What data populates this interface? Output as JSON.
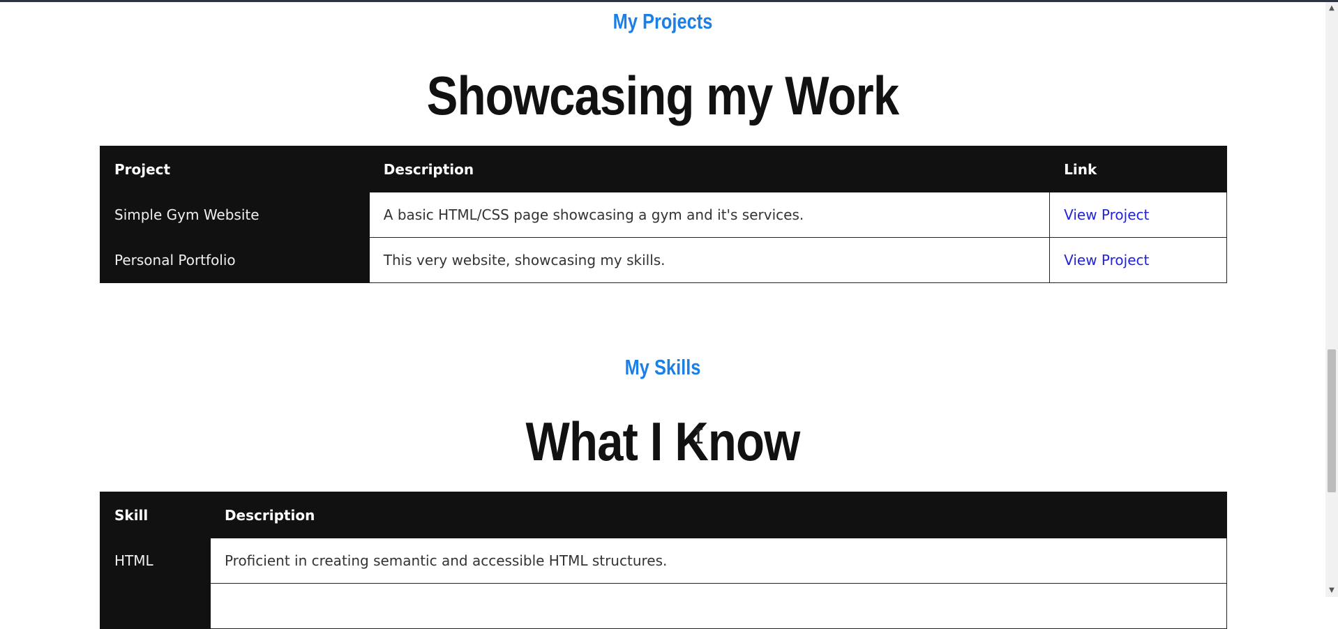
{
  "projects": {
    "kicker": "My Projects",
    "title": "Showcasing my Work",
    "headers": [
      "Project",
      "Description",
      "Link"
    ],
    "rows": [
      {
        "project": "Simple Gym Website",
        "description": "A basic HTML/CSS page showcasing a gym and it's services.",
        "link": "View Project"
      },
      {
        "project": "Personal Portfolio",
        "description": "This very website, showcasing my skills.",
        "link": "View Project"
      }
    ]
  },
  "skills": {
    "kicker": "My Skills",
    "title": "What I Know",
    "headers": [
      "Skill",
      "Description"
    ],
    "rows": [
      {
        "skill": "HTML",
        "description": "Proficient in creating semantic and accessible HTML structures."
      },
      {
        "skill": "",
        "description": ""
      }
    ]
  },
  "scrollbar": {
    "up_arrow": "▲",
    "down_arrow": "▼"
  },
  "cursor": {
    "glyph": "I"
  },
  "colors": {
    "accent": "#1a7fe6",
    "table_header_bg": "#111111",
    "link": "#2222dd"
  }
}
